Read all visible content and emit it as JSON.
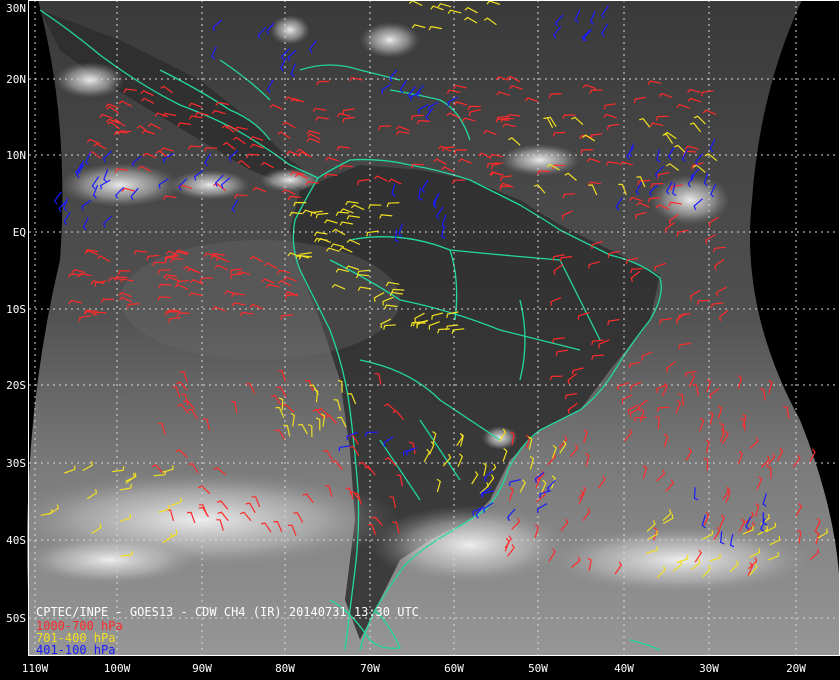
{
  "map": {
    "colors": {
      "background": "#000000",
      "coast": "#22d8a0",
      "grid": "#d8d8d8",
      "low_level": "#ff2a2a",
      "mid_level": "#f0e020",
      "high_level": "#1a1aff",
      "caption": "#ffffff"
    },
    "lat_labels": [
      "30N",
      "20N",
      "10N",
      "EQ",
      "10S",
      "20S",
      "30S",
      "40S",
      "50S"
    ],
    "lon_labels": [
      "110W",
      "100W",
      "90W",
      "80W",
      "70W",
      "60W",
      "50W",
      "40W",
      "30W",
      "20W"
    ],
    "caption": {
      "title": "CPTEC/INPE - GOES13 - CDW CH4 (IR) 20140731 13:30 UTC",
      "legend": [
        {
          "label": "1000-700 hPa",
          "color": "#ff2a2a"
        },
        {
          "label": "701-400 hPa",
          "color": "#f0e020"
        },
        {
          "label": "401-100 hPa",
          "color": "#1a1aff"
        }
      ]
    }
  }
}
